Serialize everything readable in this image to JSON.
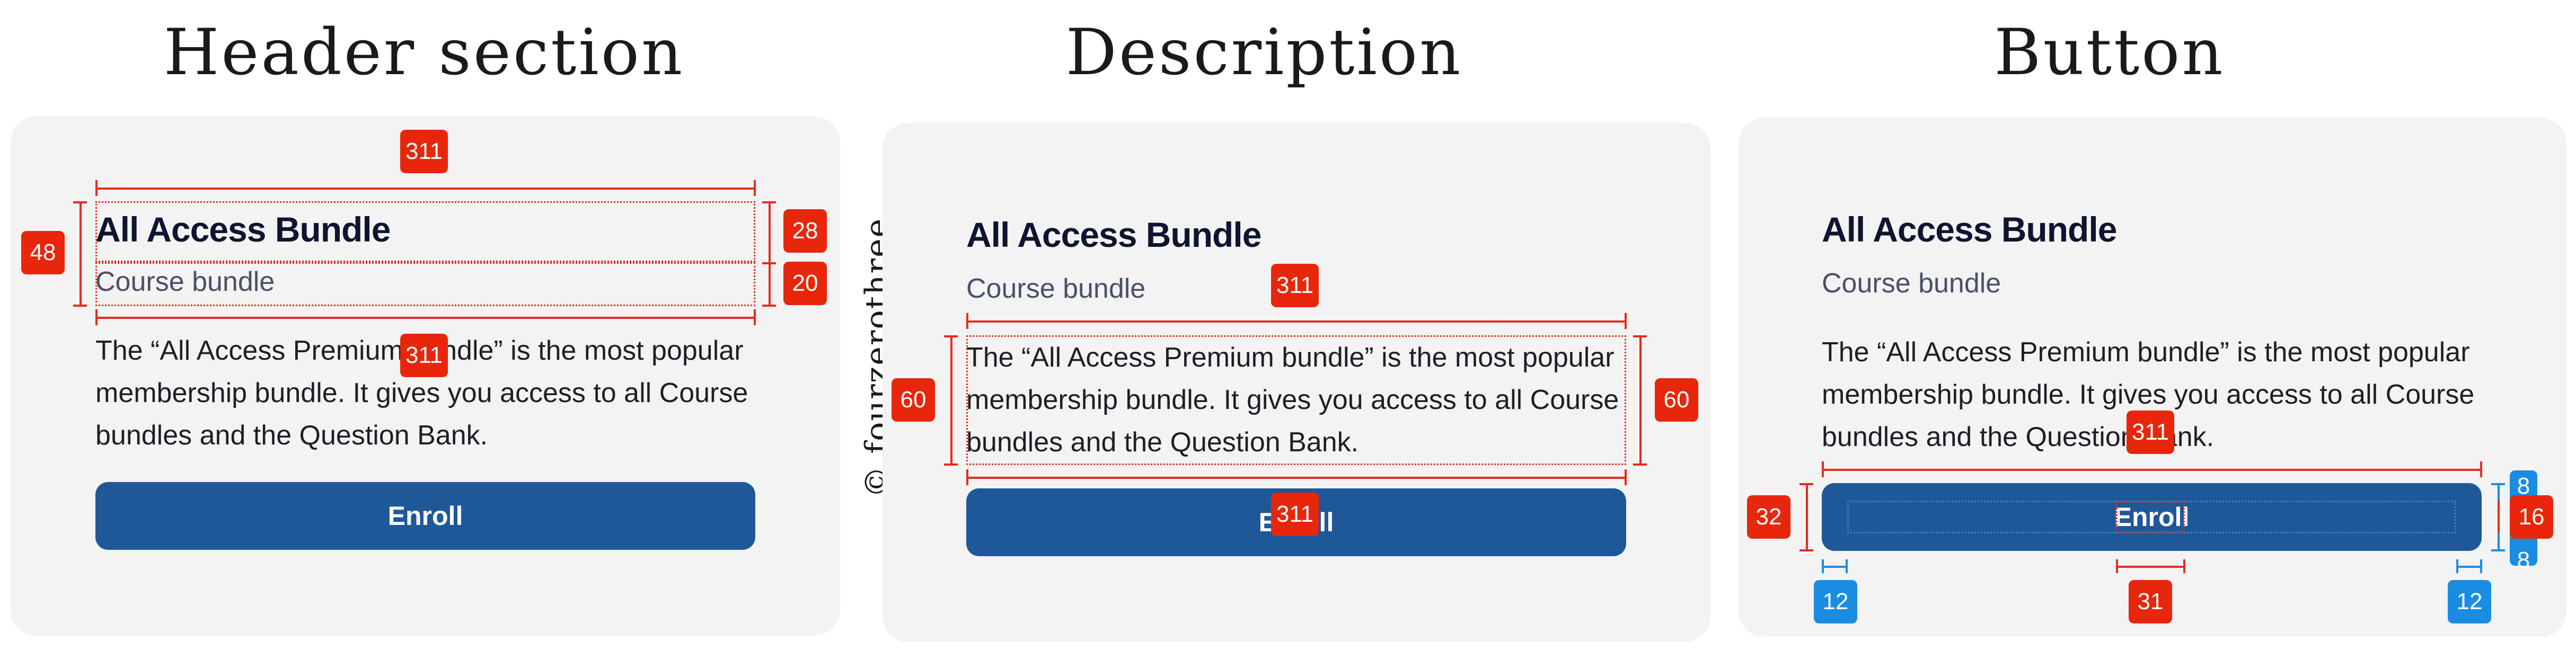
{
  "sections": {
    "header_title": "Header section",
    "description_title": "Description",
    "button_title": "Button"
  },
  "card": {
    "title": "All Access Bundle",
    "subtitle": "Course bundle",
    "description": "The “All Access Premium bundle” is the most popular membership bundle. It gives you access to all Course bundles and the Question Bank.",
    "button_label": "Enroll"
  },
  "measurements": {
    "width": "311",
    "header_height": "48",
    "title_height": "28",
    "subtitle_height": "20",
    "description_height": "60",
    "button_height": "32",
    "button_padding_x": "12",
    "button_label_width": "31",
    "button_label_height": "16",
    "button_padding_y_top": "8",
    "button_padding_y_bottom": "8"
  },
  "watermark": "© fourzerothree",
  "colors": {
    "panel_bg": "#f3f3f3",
    "button_bg": "#1f5898",
    "measure_red": "#e62b1e",
    "measure_blue": "#1a8de3"
  }
}
